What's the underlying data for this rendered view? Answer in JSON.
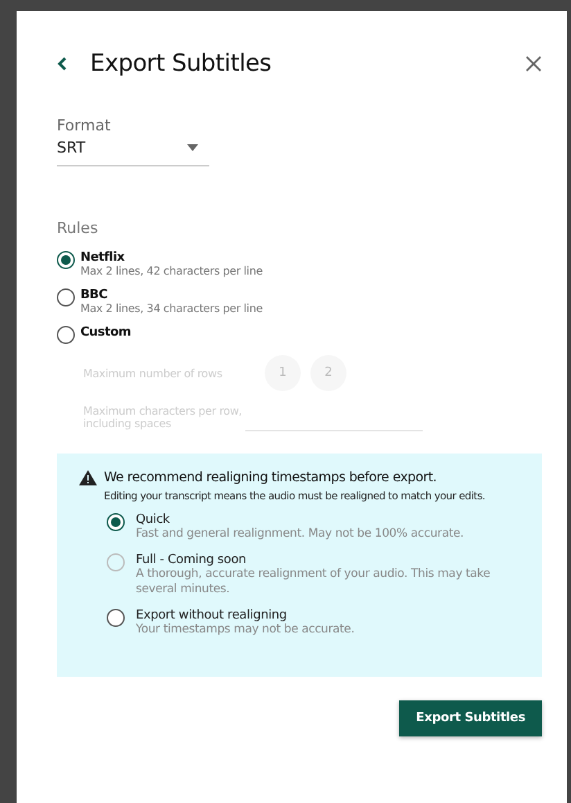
{
  "header": {
    "title": "Export Subtitles"
  },
  "format": {
    "label": "Format",
    "value": "SRT"
  },
  "rules": {
    "label": "Rules",
    "options": [
      {
        "title": "Netflix",
        "description": "Max 2 lines, 42 characters per line",
        "selected": true
      },
      {
        "title": "BBC",
        "description": "Max 2 lines, 34 characters per line",
        "selected": false
      },
      {
        "title": "Custom",
        "selected": false
      }
    ]
  },
  "custom": {
    "disabled": true,
    "rows_label": "Maximum number of rows",
    "row_choices": [
      {
        "label": "1",
        "selected": false
      },
      {
        "label": "2",
        "selected": false
      }
    ],
    "chars_label": "Maximum characters per row, including spaces"
  },
  "alert": {
    "title": "We recommend realigning timestamps before export.",
    "message": "Editing your transcript means the audio must be realigned to match your edits.",
    "options": [
      {
        "title": "Quick",
        "description": "Fast and general realignment. May not be 100% accurate.",
        "selected": true,
        "disabled": false
      },
      {
        "title": "Full - Coming soon",
        "description": "A thorough, accurate realignment of your audio. This may take several minutes.",
        "selected": false,
        "disabled": true
      },
      {
        "title": "Export without realigning",
        "description": "Your timestamps may not be accurate.",
        "selected": false,
        "disabled": false
      }
    ]
  },
  "buttons": [
    "Export Subtitles"
  ]
}
